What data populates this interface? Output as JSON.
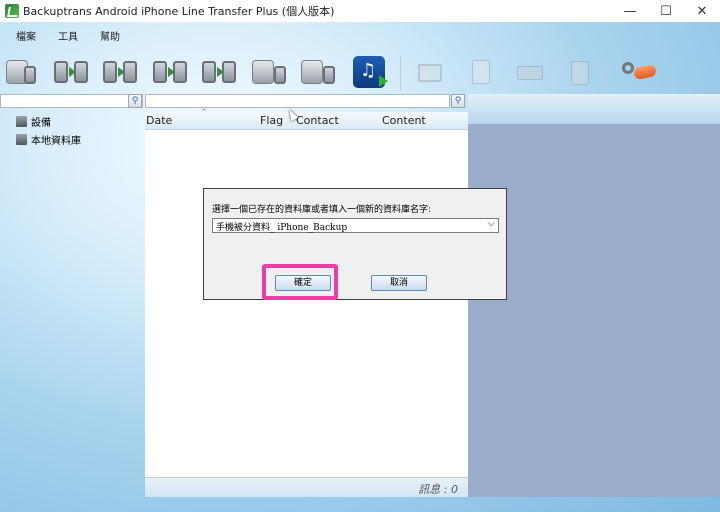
{
  "window": {
    "title": "Backuptrans Android iPhone Line Transfer Plus (個人版本)",
    "minimize_glyph": "—",
    "maximize_glyph": "☐",
    "close_glyph": "✕"
  },
  "menu": {
    "items": [
      "檔案",
      "工具",
      "幫助"
    ]
  },
  "toolbar": {
    "icons": [
      "backup-database-icon",
      "transfer-android-to-iphone-icon",
      "transfer-iphone-to-android-icon",
      "transfer-android-to-android-icon",
      "transfer-iphone-to-iphone-icon",
      "restore-to-android-icon",
      "restore-to-iphone-icon",
      "itunes-transfer-icon",
      "export-photos-icon",
      "export-document-icon",
      "print-icon",
      "delete-icon",
      "register-key-icon"
    ]
  },
  "left_panel": {
    "search_placeholder": "",
    "tree": [
      {
        "label": "設備",
        "icon": "device-icon"
      },
      {
        "label": "本地資料庫",
        "icon": "local-database-icon"
      }
    ]
  },
  "list": {
    "columns": {
      "date": "Date",
      "flag": "Flag",
      "contact": "Contact",
      "content": "Content"
    },
    "sort_indicator": "^",
    "status": "訊息 : 0"
  },
  "dialog": {
    "prompt": "選擇一個已存在的資料庫或者填入一個新的資料庫名字:",
    "combo_value": "手機被分資料_ iPhone_Backup",
    "combo_arrow": "⌵",
    "ok_label": "確定",
    "cancel_label": "取消"
  },
  "colors": {
    "highlight": "#e83fa6",
    "right_panel": "#9aaecb"
  }
}
